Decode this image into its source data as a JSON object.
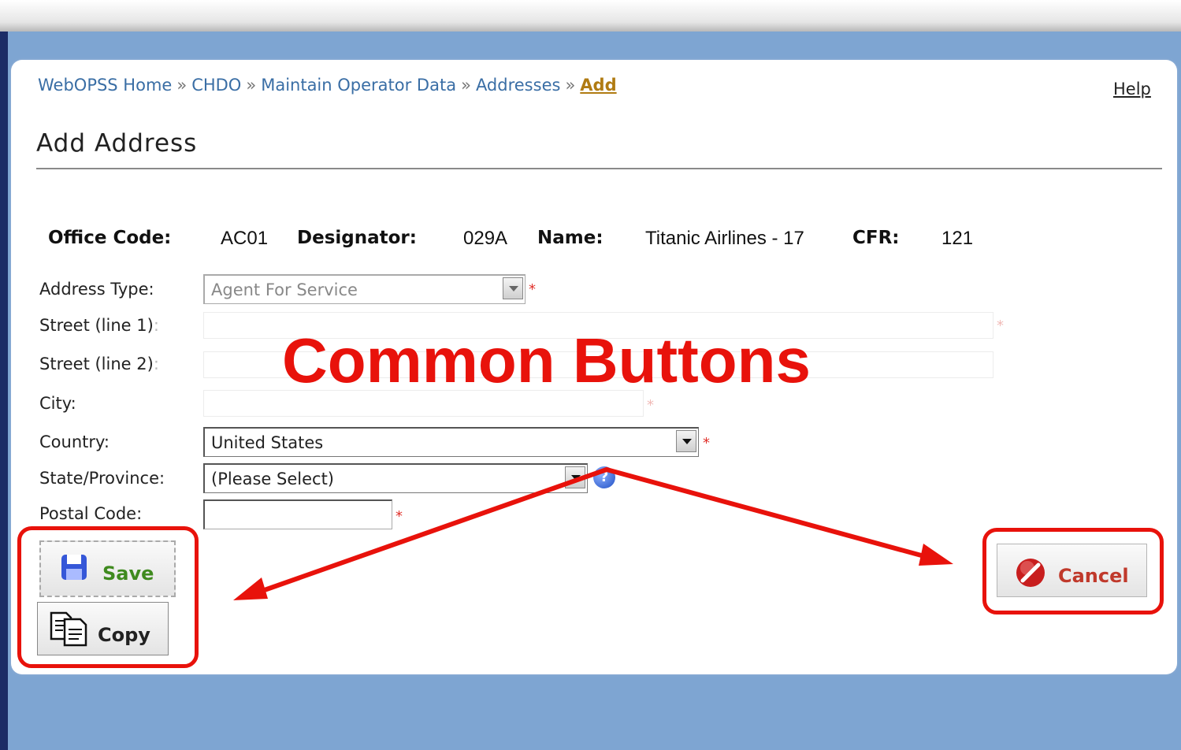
{
  "breadcrumb": {
    "items": [
      "WebOPSS Home",
      "CHDO",
      "Maintain Operator Data",
      "Addresses"
    ],
    "separator": "»",
    "current": "Add"
  },
  "help_label": "Help",
  "page_title": "Add Address",
  "info": {
    "office_code_label": "Office Code:",
    "office_code": "AC01",
    "designator_label": "Designator:",
    "designator": "029A",
    "name_label": "Name:",
    "name": "Titanic Airlines - 17",
    "cfr_label": "CFR:",
    "cfr": "121"
  },
  "form": {
    "address_type_label": "Address Type:",
    "address_type_value": "Agent For Service",
    "street1_label": "Street (line 1)",
    "street2_label": "Street (line 2)",
    "colon": ":",
    "city_label": "City:",
    "country_label": "Country:",
    "country_value": "United States",
    "state_label": "State/Province:",
    "state_value": "(Please Select)",
    "postal_label": "Postal Code:",
    "required_mark": "*"
  },
  "buttons": {
    "save": "Save",
    "copy": "Copy",
    "cancel": "Cancel"
  },
  "annotation": {
    "text": "Common Buttons"
  },
  "colors": {
    "annotation": "#e8120b",
    "link": "#3a6ea5",
    "save_text": "#3f8a1e",
    "cancel_text": "#c0392b"
  }
}
